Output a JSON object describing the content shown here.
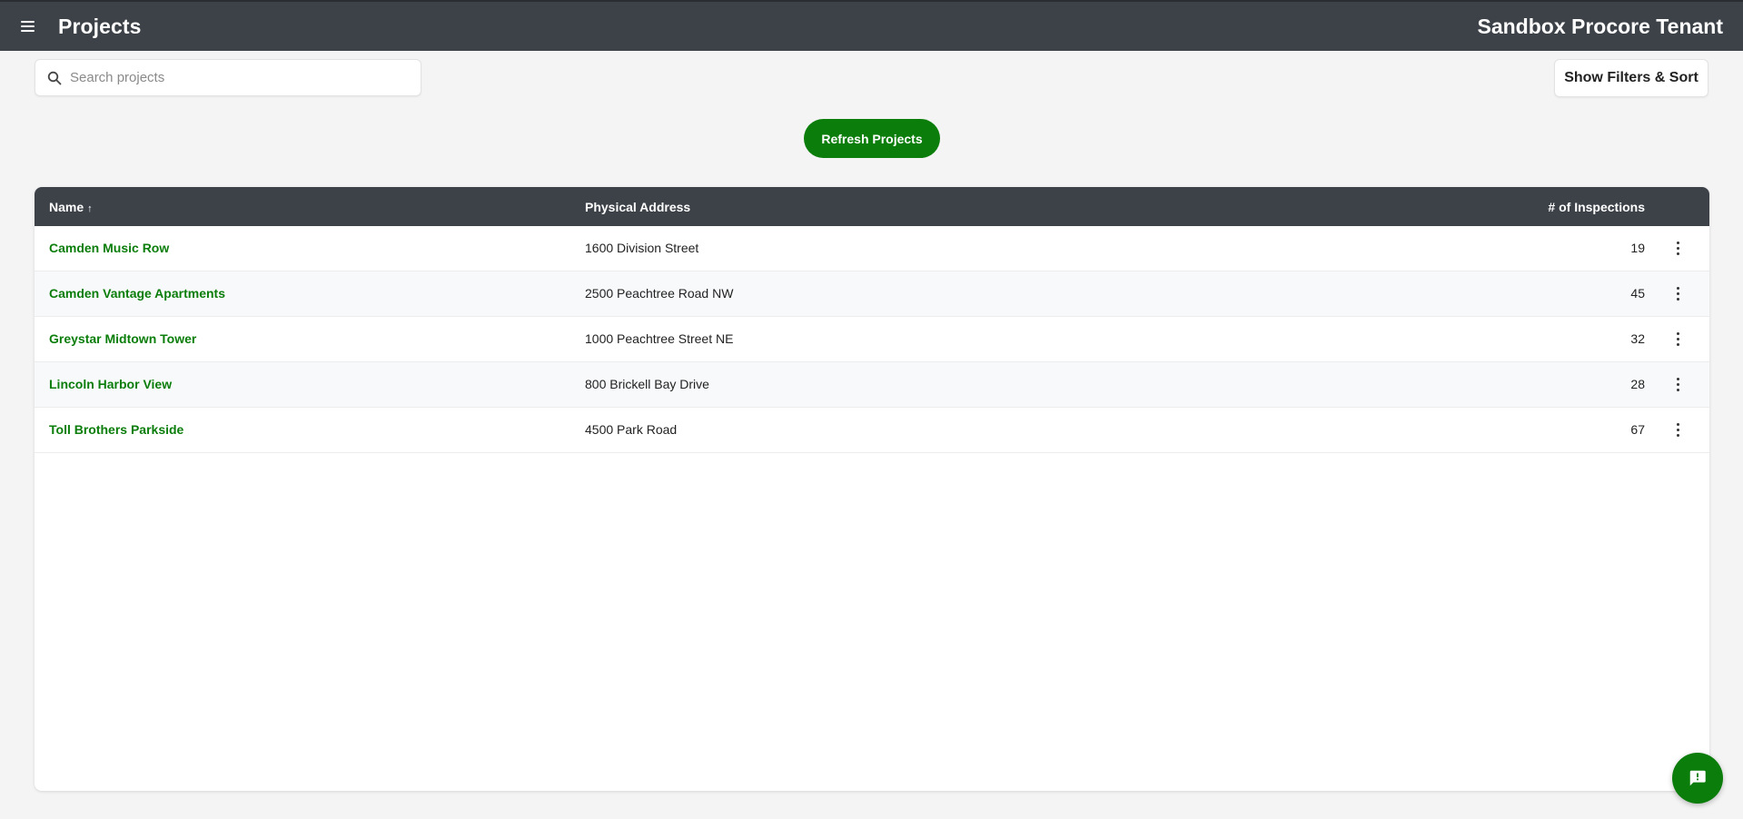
{
  "header": {
    "title": "Projects",
    "tenant": "Sandbox Procore Tenant"
  },
  "search": {
    "placeholder": "Search projects",
    "value": ""
  },
  "toolbar": {
    "filters_label": "Show Filters & Sort",
    "refresh_label": "Refresh Projects"
  },
  "table": {
    "columns": {
      "name": "Name",
      "name_sort": "↑",
      "address": "Physical Address",
      "inspections": "# of Inspections"
    },
    "rows": [
      {
        "name": "Camden Music Row",
        "address": "1600 Division Street",
        "inspections": "19"
      },
      {
        "name": "Camden Vantage Apartments",
        "address": "2500 Peachtree Road NW",
        "inspections": "45"
      },
      {
        "name": "Greystar Midtown Tower",
        "address": "1000 Peachtree Street NE",
        "inspections": "32"
      },
      {
        "name": "Lincoln Harbor View",
        "address": "800 Brickell Bay Drive",
        "inspections": "28"
      },
      {
        "name": "Toll Brothers Parkside",
        "address": "4500 Park Road",
        "inspections": "67"
      }
    ]
  },
  "icons": {
    "menu": "hamburger-menu-icon",
    "search": "search-icon",
    "row_actions": "more-vertical-icon",
    "feedback": "feedback-chat-icon"
  },
  "colors": {
    "header_bg": "#3d4249",
    "accent_green": "#0a7d0a",
    "page_bg": "#f4f4f4"
  }
}
